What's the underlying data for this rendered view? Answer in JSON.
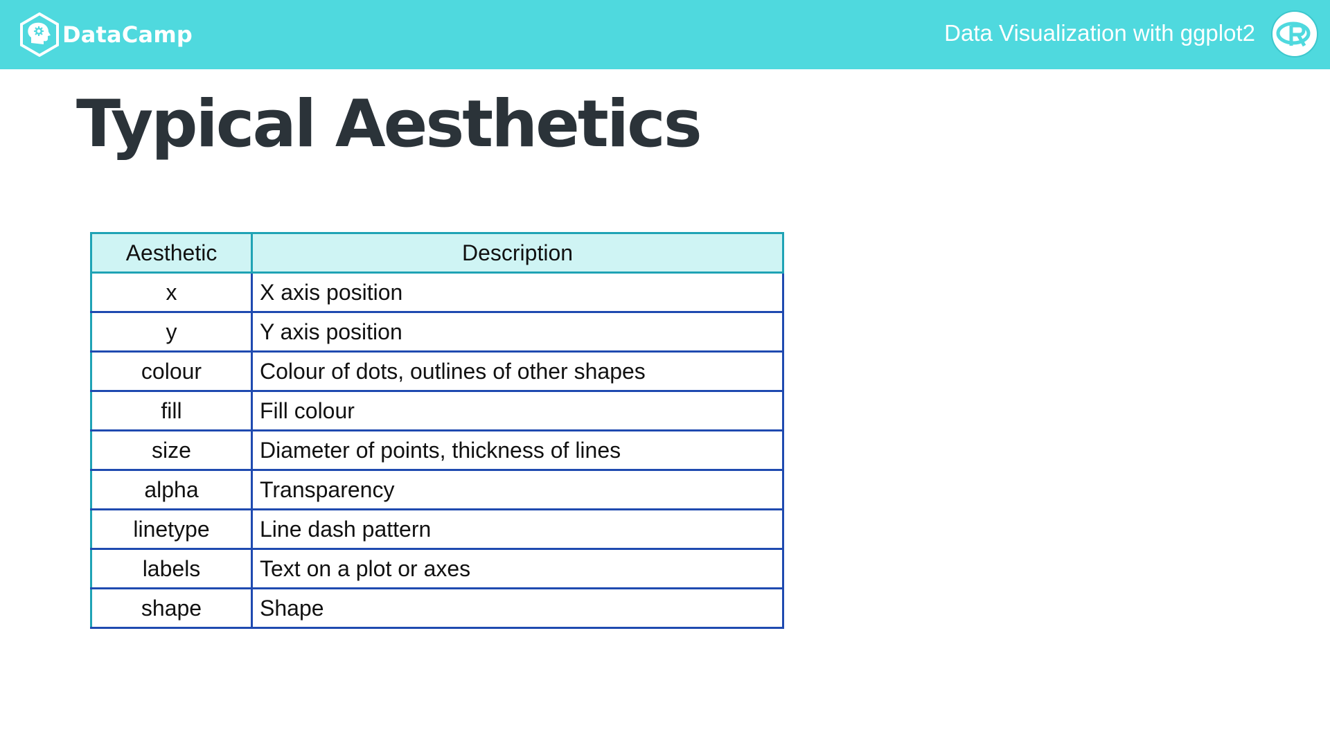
{
  "header": {
    "brand_name": "DataCamp",
    "course_title": "Data Visualization with ggplot2",
    "brand_logo_icon": "datacamp-hexagon-icon",
    "course_logo_icon": "r-language-icon",
    "accent_color": "#4fd9de"
  },
  "slide": {
    "title": "Typical Aesthetics"
  },
  "table": {
    "columns": [
      "Aesthetic",
      "Description"
    ],
    "rows": [
      {
        "aesthetic": "x",
        "description": "X axis position"
      },
      {
        "aesthetic": "y",
        "description": "Y axis position"
      },
      {
        "aesthetic": "colour",
        "description": "Colour of dots, outlines of other shapes"
      },
      {
        "aesthetic": "fill",
        "description": "Fill colour"
      },
      {
        "aesthetic": "size",
        "description": "Diameter of points, thickness of lines"
      },
      {
        "aesthetic": "alpha",
        "description": "Transparency"
      },
      {
        "aesthetic": "linetype",
        "description": "Line dash pattern"
      },
      {
        "aesthetic": "labels",
        "description": "Text on a plot or axes"
      },
      {
        "aesthetic": "shape",
        "description": "Shape"
      }
    ],
    "header_background": "#cff4f4",
    "border_color": "#1f4ab0"
  }
}
